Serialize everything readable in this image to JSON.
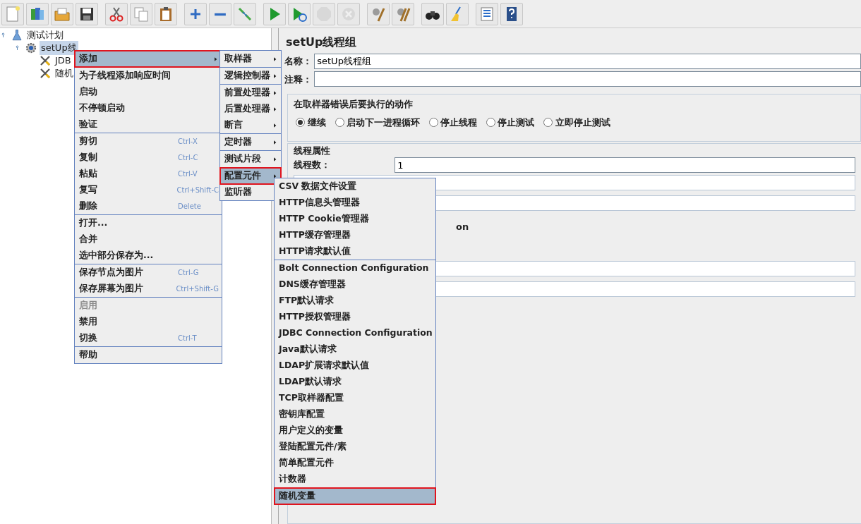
{
  "toolbar": {
    "groups": [
      [
        {
          "disabled": false
        },
        {
          "disabled": false
        },
        {
          "disabled": false
        },
        {
          "disabled": false
        }
      ],
      [
        {
          "disabled": false
        },
        {
          "disabled": false
        },
        {
          "disabled": false
        }
      ],
      [
        {
          "disabled": false
        },
        {
          "disabled": false
        },
        {
          "disabled": false
        }
      ],
      [
        {
          "disabled": false
        },
        {
          "disabled": false
        },
        {
          "disabled": true
        },
        {
          "disabled": true
        }
      ],
      [
        {
          "disabled": false
        },
        {
          "disabled": false
        }
      ],
      [
        {
          "disabled": false
        },
        {
          "disabled": false
        }
      ],
      [
        {
          "disabled": false
        },
        {
          "disabled": false
        }
      ]
    ]
  },
  "tree": [
    {
      "label": "测试计划",
      "selected": false,
      "kind": "plan",
      "children": [
        {
          "label": "setUp线",
          "selected": true,
          "kind": "group",
          "children": [
            {
              "label": "JDB",
              "selected": false,
              "kind": "tool"
            },
            {
              "label": "随机",
              "selected": false,
              "kind": "tool"
            }
          ]
        }
      ]
    }
  ],
  "panel": {
    "title": "setUp线程组",
    "name_label": "名称：",
    "name_value": "setUp线程组",
    "comment_label": "注释：",
    "error_action": {
      "legend": "在取样器错误后要执行的动作",
      "options": [
        {
          "label": "继续",
          "selected": true
        },
        {
          "label": "启动下一进程循环",
          "selected": false
        },
        {
          "label": "停止线程",
          "selected": false
        },
        {
          "label": "停止测试",
          "selected": false
        },
        {
          "label": "立即停止测试",
          "selected": false
        }
      ]
    },
    "thread_props": {
      "legend": "线程属性",
      "threads_label": "线程数：",
      "threads_value": "1",
      "fragment": "on"
    }
  },
  "context_menu": {
    "sections": [
      [
        {
          "label": "添加",
          "submenu": true,
          "selected": true,
          "annotated": true,
          "disabled": false
        }
      ],
      [
        {
          "label": "为子线程添加响应时间",
          "submenu": false,
          "selected": false,
          "annotated": false,
          "disabled": false
        },
        {
          "label": "启动",
          "submenu": false,
          "selected": false,
          "annotated": false,
          "disabled": false
        },
        {
          "label": "不停顿启动",
          "submenu": false,
          "selected": false,
          "annotated": false,
          "disabled": false
        },
        {
          "label": "验证",
          "submenu": false,
          "selected": false,
          "annotated": false,
          "disabled": false
        }
      ],
      [
        {
          "label": "剪切",
          "shortcut": "Ctrl-X",
          "submenu": false,
          "selected": false,
          "annotated": false,
          "disabled": false
        },
        {
          "label": "复制",
          "shortcut": "Ctrl-C",
          "submenu": false,
          "selected": false,
          "annotated": false,
          "disabled": false
        },
        {
          "label": "粘贴",
          "shortcut": "Ctrl-V",
          "submenu": false,
          "selected": false,
          "annotated": false,
          "disabled": false
        },
        {
          "label": "复写",
          "shortcut": "Ctrl+Shift-C",
          "submenu": false,
          "selected": false,
          "annotated": false,
          "disabled": false
        },
        {
          "label": "删除",
          "shortcut": "Delete",
          "submenu": false,
          "selected": false,
          "annotated": false,
          "disabled": false
        }
      ],
      [
        {
          "label": "打开...",
          "submenu": false,
          "selected": false,
          "annotated": false,
          "disabled": false
        },
        {
          "label": "合并",
          "submenu": false,
          "selected": false,
          "annotated": false,
          "disabled": false
        },
        {
          "label": "选中部分保存为...",
          "submenu": false,
          "selected": false,
          "annotated": false,
          "disabled": false
        }
      ],
      [
        {
          "label": "保存节点为图片",
          "shortcut": "Ctrl-G",
          "submenu": false,
          "selected": false,
          "annotated": false,
          "disabled": false
        },
        {
          "label": "保存屏幕为图片",
          "shortcut": "Ctrl+Shift-G",
          "submenu": false,
          "selected": false,
          "annotated": false,
          "disabled": false
        }
      ],
      [
        {
          "label": "启用",
          "submenu": false,
          "selected": false,
          "annotated": false,
          "disabled": true
        },
        {
          "label": "禁用",
          "submenu": false,
          "selected": false,
          "annotated": false,
          "disabled": false
        },
        {
          "label": "切换",
          "shortcut": "Ctrl-T",
          "submenu": false,
          "selected": false,
          "annotated": false,
          "disabled": false
        }
      ],
      [
        {
          "label": "帮助",
          "submenu": false,
          "selected": false,
          "annotated": false,
          "disabled": false
        }
      ]
    ]
  },
  "add_submenu": {
    "sections": [
      [
        {
          "label": "取样器",
          "submenu": true,
          "selected": false,
          "annotated": false,
          "disabled": false
        }
      ],
      [
        {
          "label": "逻辑控制器",
          "submenu": true,
          "selected": false,
          "annotated": false,
          "disabled": false
        }
      ],
      [
        {
          "label": "前置处理器",
          "submenu": true,
          "selected": false,
          "annotated": false,
          "disabled": false
        },
        {
          "label": "后置处理器",
          "submenu": true,
          "selected": false,
          "annotated": false,
          "disabled": false
        },
        {
          "label": "断言",
          "submenu": true,
          "selected": false,
          "annotated": false,
          "disabled": false
        }
      ],
      [
        {
          "label": "定时器",
          "submenu": true,
          "selected": false,
          "annotated": false,
          "disabled": false
        }
      ],
      [
        {
          "label": "测试片段",
          "submenu": true,
          "selected": false,
          "annotated": false,
          "disabled": false
        }
      ],
      [
        {
          "label": "配置元件",
          "submenu": true,
          "selected": true,
          "annotated": true,
          "disabled": false
        },
        {
          "label": "监听器",
          "submenu": true,
          "selected": false,
          "annotated": false,
          "disabled": false
        }
      ]
    ]
  },
  "config_submenu": {
    "sections": [
      [
        {
          "label": "CSV 数据文件设置",
          "submenu": false,
          "selected": false,
          "annotated": false,
          "disabled": false
        },
        {
          "label": "HTTP信息头管理器",
          "submenu": false,
          "selected": false,
          "annotated": false,
          "disabled": false
        },
        {
          "label": "HTTP Cookie管理器",
          "submenu": false,
          "selected": false,
          "annotated": false,
          "disabled": false
        },
        {
          "label": "HTTP缓存管理器",
          "submenu": false,
          "selected": false,
          "annotated": false,
          "disabled": false
        },
        {
          "label": "HTTP请求默认值",
          "submenu": false,
          "selected": false,
          "annotated": false,
          "disabled": false
        }
      ],
      [
        {
          "label": "Bolt Connection Configuration",
          "submenu": false,
          "selected": false,
          "annotated": false,
          "disabled": false
        },
        {
          "label": "DNS缓存管理器",
          "submenu": false,
          "selected": false,
          "annotated": false,
          "disabled": false
        },
        {
          "label": "FTP默认请求",
          "submenu": false,
          "selected": false,
          "annotated": false,
          "disabled": false
        },
        {
          "label": "HTTP授权管理器",
          "submenu": false,
          "selected": false,
          "annotated": false,
          "disabled": false
        },
        {
          "label": "JDBC Connection Configuration",
          "submenu": false,
          "selected": false,
          "annotated": false,
          "disabled": false
        },
        {
          "label": "Java默认请求",
          "submenu": false,
          "selected": false,
          "annotated": false,
          "disabled": false
        },
        {
          "label": "LDAP扩展请求默认值",
          "submenu": false,
          "selected": false,
          "annotated": false,
          "disabled": false
        },
        {
          "label": "LDAP默认请求",
          "submenu": false,
          "selected": false,
          "annotated": false,
          "disabled": false
        },
        {
          "label": "TCP取样器配置",
          "submenu": false,
          "selected": false,
          "annotated": false,
          "disabled": false
        },
        {
          "label": "密钥库配置",
          "submenu": false,
          "selected": false,
          "annotated": false,
          "disabled": false
        },
        {
          "label": "用户定义的变量",
          "submenu": false,
          "selected": false,
          "annotated": false,
          "disabled": false
        },
        {
          "label": "登陆配置元件/素",
          "submenu": false,
          "selected": false,
          "annotated": false,
          "disabled": false
        },
        {
          "label": "简单配置元件",
          "submenu": false,
          "selected": false,
          "annotated": false,
          "disabled": false
        },
        {
          "label": "计数器",
          "submenu": false,
          "selected": false,
          "annotated": false,
          "disabled": false
        }
      ],
      [
        {
          "label": "随机变量",
          "submenu": false,
          "selected": true,
          "annotated": true,
          "disabled": false
        }
      ]
    ]
  }
}
